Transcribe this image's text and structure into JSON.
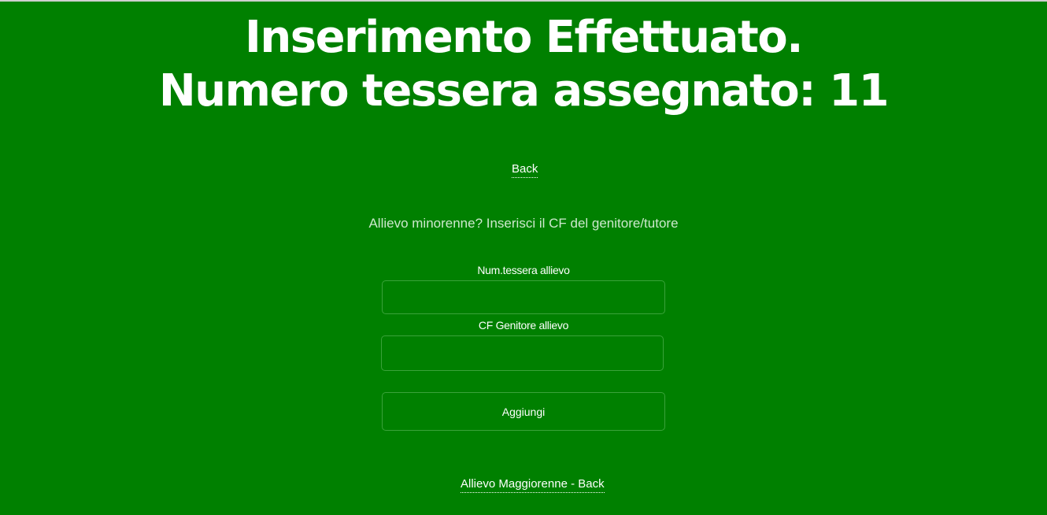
{
  "header": {
    "line1": "Inserimento Effettuato.",
    "line2": "Numero tessera assegnato: 11"
  },
  "back_link": "Back",
  "subtitle": "Allievo minorenne? Inserisci il CF del genitore/tutore",
  "form": {
    "num_tessera_label": "Num.tessera allievo",
    "num_tessera_value": "",
    "cf_genitore_label": "CF Genitore allievo",
    "cf_genitore_value": "",
    "submit_label": "Aggiungi"
  },
  "bottom_link": "Allievo Maggiorenne - Back",
  "colors": {
    "background": "#008000",
    "text": "#ffffff",
    "field_border": "#3aa23a"
  }
}
